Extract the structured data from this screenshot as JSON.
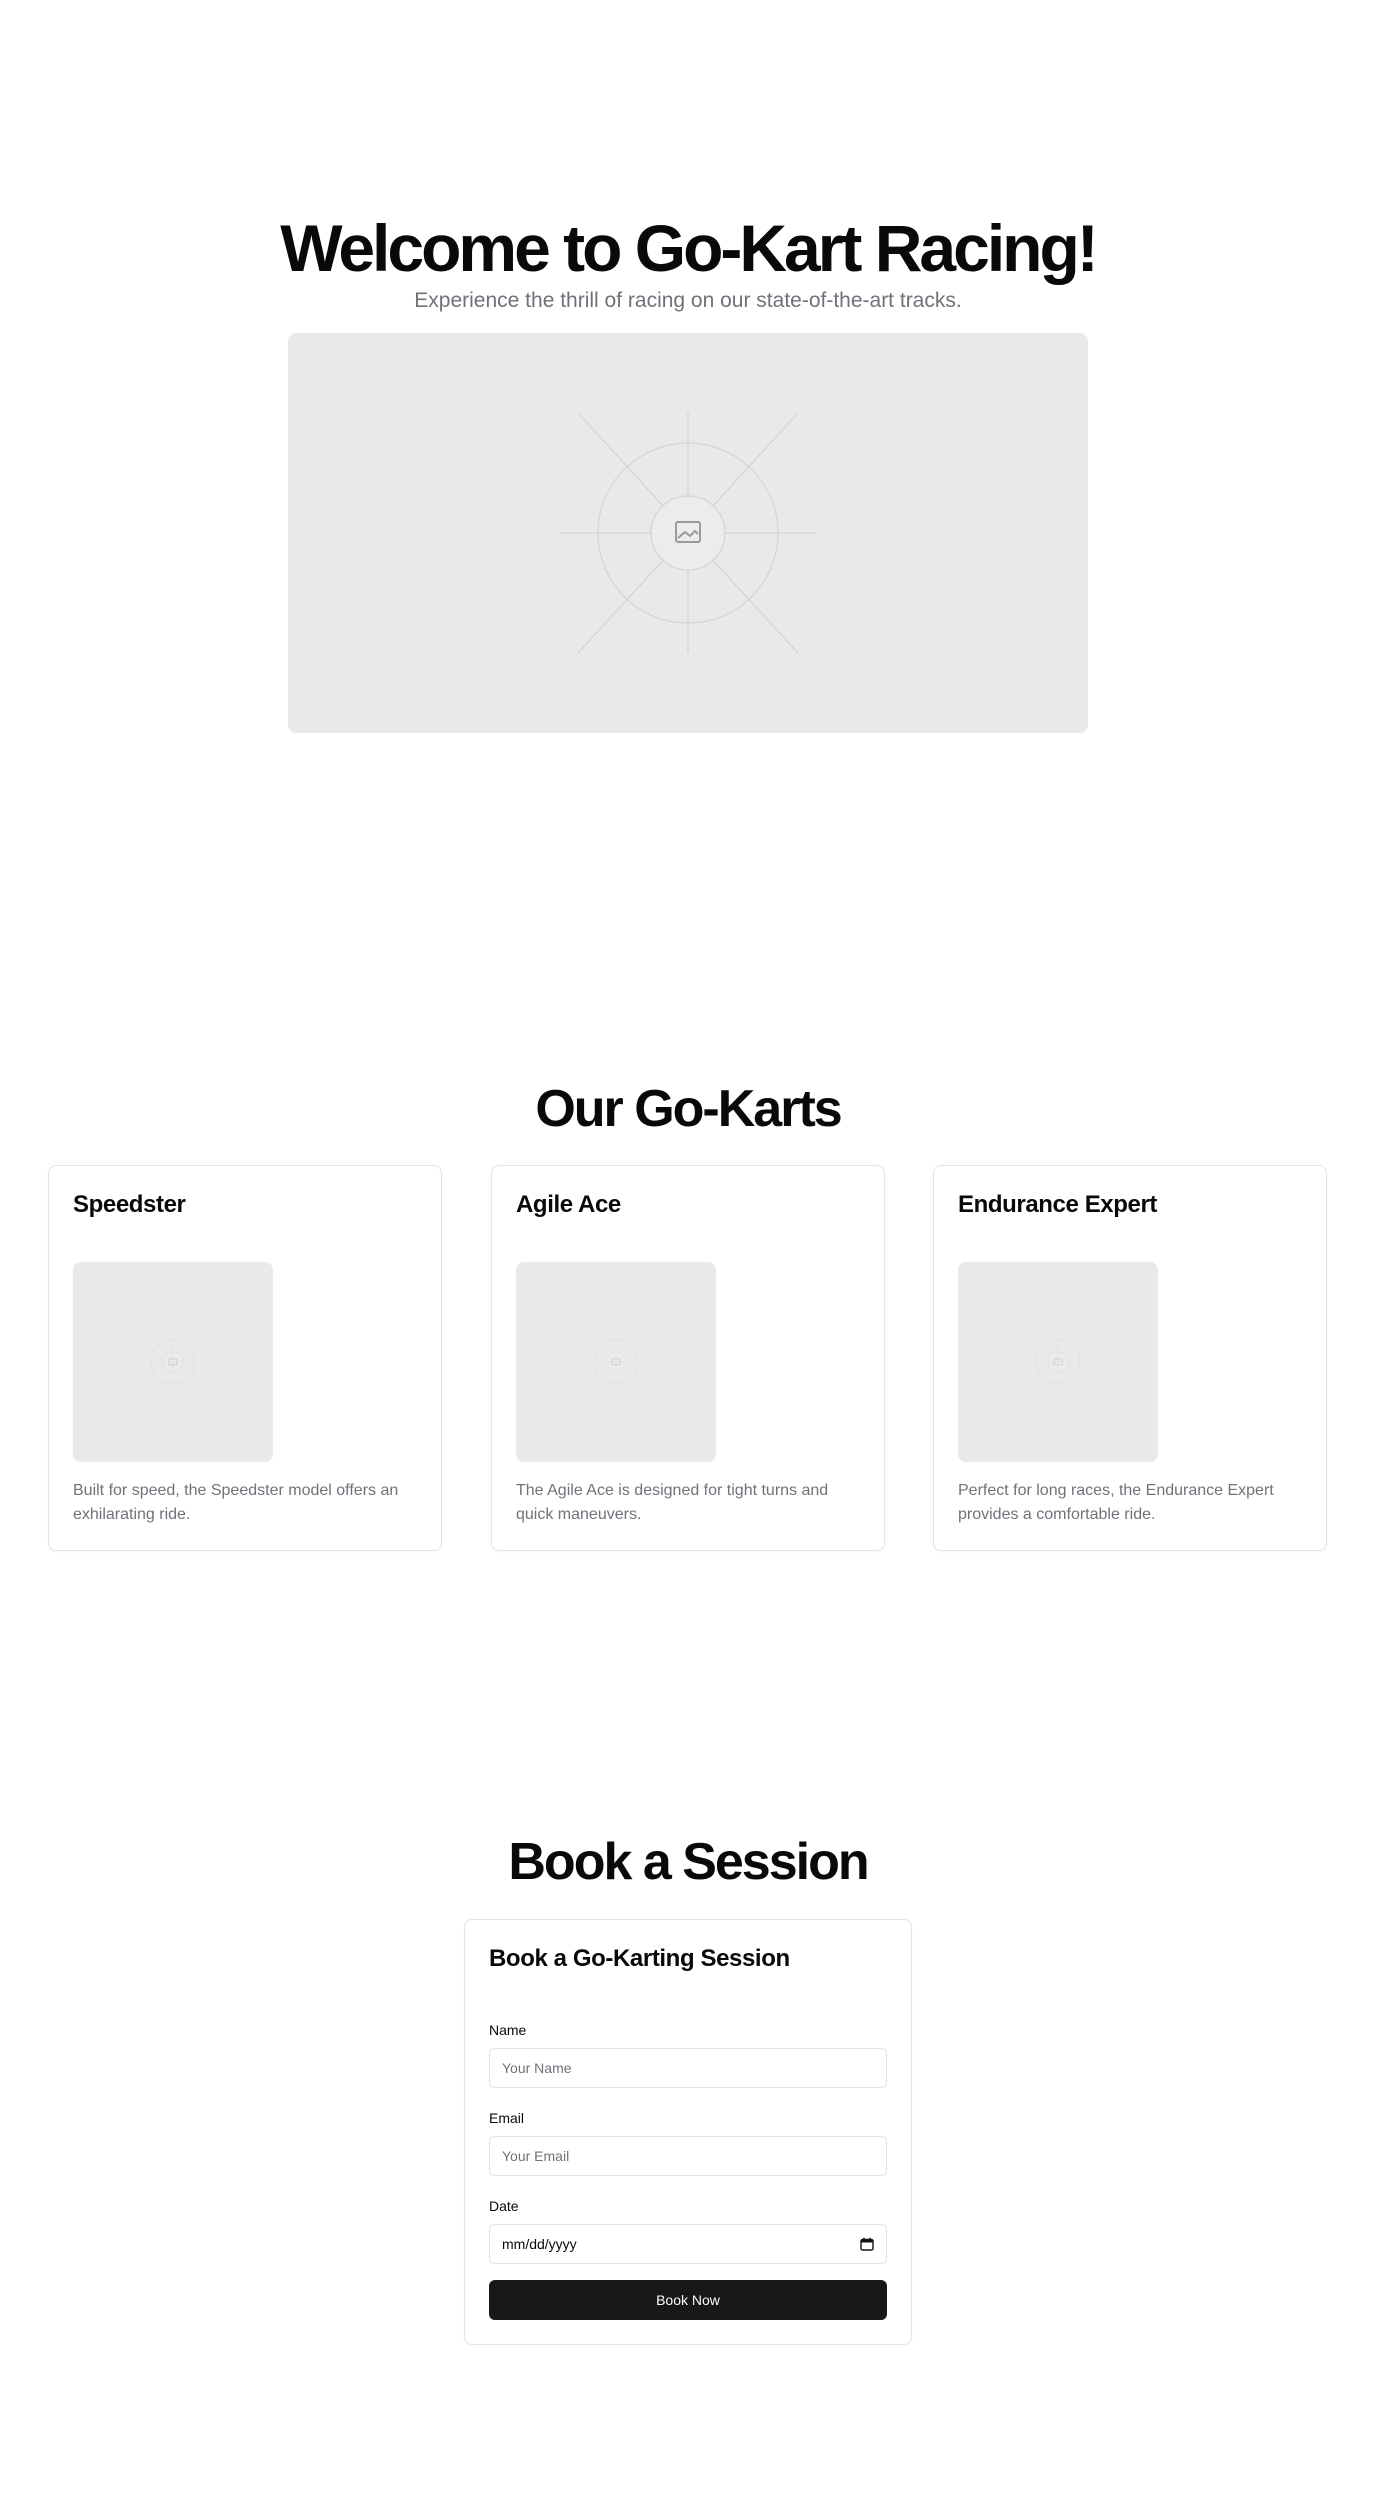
{
  "hero": {
    "title": "Welcome to Go-Kart Racing!",
    "subtitle": "Experience the thrill of racing on our state-of-the-art tracks.",
    "image_icon": "image-placeholder-icon"
  },
  "karts": {
    "title": "Our Go-Karts",
    "items": [
      {
        "name": "Speedster",
        "description": "Built for speed, the Speedster model offers an exhilarating ride."
      },
      {
        "name": "Agile Ace",
        "description": "The Agile Ace is designed for tight turns and quick maneuvers."
      },
      {
        "name": "Endurance Expert",
        "description": "Perfect for long races, the Endurance Expert provides a comfortable ride."
      }
    ]
  },
  "booking": {
    "title": "Book a Session",
    "card_title": "Book a Go-Karting Session",
    "fields": {
      "name": {
        "label": "Name",
        "placeholder": "Your Name"
      },
      "email": {
        "label": "Email",
        "placeholder": "Your Email"
      },
      "date": {
        "label": "Date",
        "value": "mm/dd/yyyy",
        "icon": "calendar-icon"
      }
    },
    "submit_label": "Book Now"
  },
  "colors": {
    "text": "#09090b",
    "muted": "#71717a",
    "border": "#e4e4e7",
    "placeholder_bg": "#e9e9e9",
    "button_bg": "#18181b",
    "button_text": "#fafafa"
  }
}
